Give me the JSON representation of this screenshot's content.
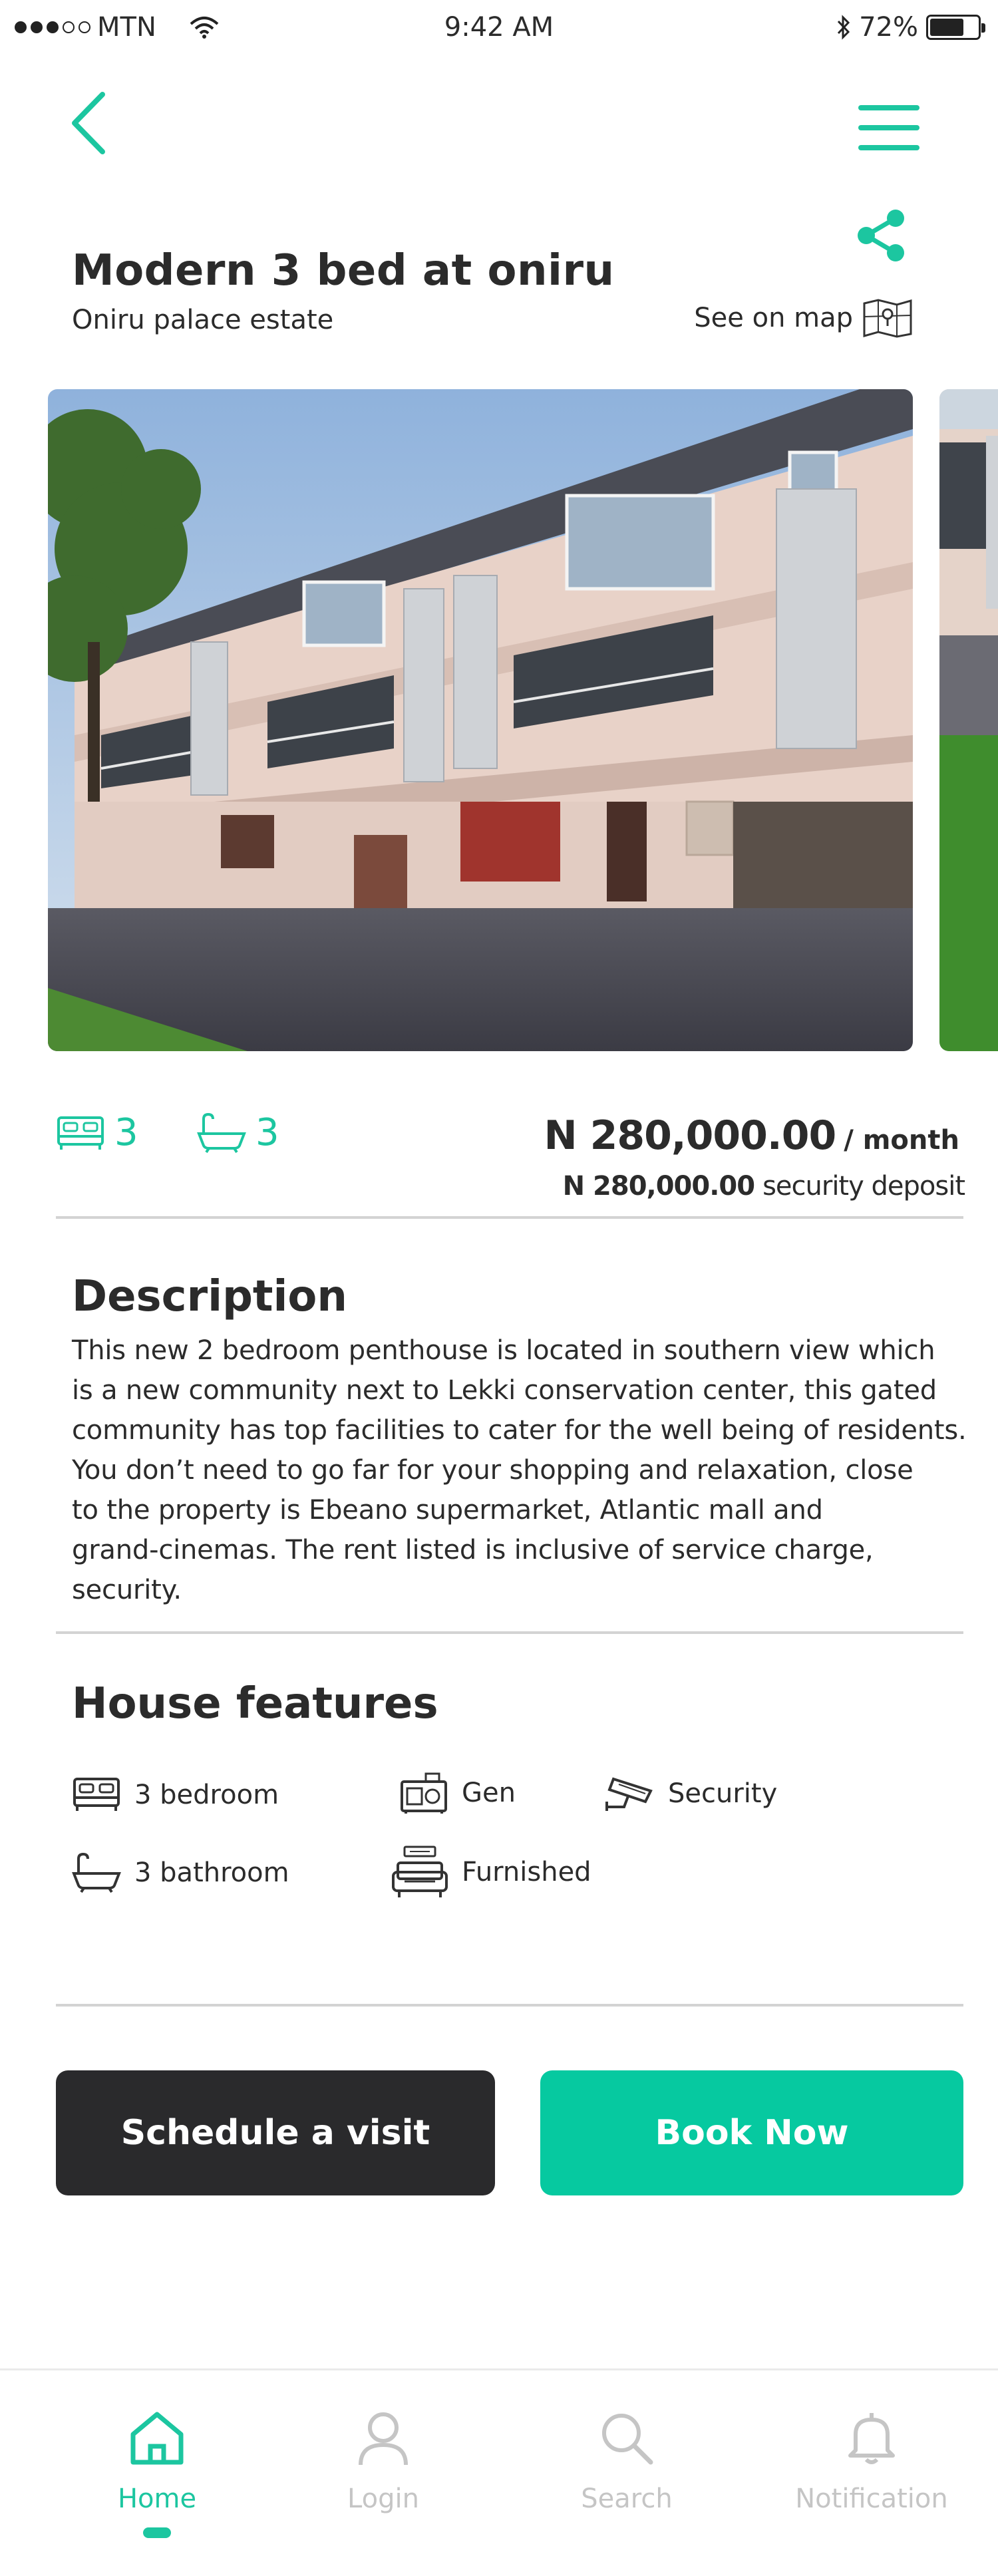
{
  "status_bar": {
    "carrier": "MTN",
    "time": "9:42 AM",
    "battery": "72%",
    "battery_level": 0.72
  },
  "listing": {
    "title": "Modern 3 bed at oniru",
    "location": "Oniru palace estate",
    "see_on_map": "See on map",
    "bedrooms": "3",
    "bathrooms": "3",
    "price": "N 280,000.00",
    "price_period": "/ month",
    "deposit_amount": "N 280,000.00",
    "deposit_label": "security deposit"
  },
  "description": {
    "heading": "Description",
    "text": "This new 2 bedroom penthouse is located in southern view which\n is a new community next to Lekki conservation center, this gated\n community has top facilities to cater for the well being of residents.\nYou don’t need to go far for your shopping and relaxation, close\nto the property is Ebeano supermarket, Atlantic mall and\ngrand-cinemas. The rent listed is inclusive of service charge,\nsecurity."
  },
  "features": {
    "heading": "House features",
    "items": [
      {
        "label": "3 bedroom",
        "icon": "bed-icon"
      },
      {
        "label": "Gen",
        "icon": "generator-icon"
      },
      {
        "label": "Security",
        "icon": "cctv-camera-icon"
      },
      {
        "label": "3 bathroom",
        "icon": "bathtub-icon"
      },
      {
        "label": "Furnished",
        "icon": "sofa-icon"
      }
    ]
  },
  "actions": {
    "schedule_label": "Schedule a visit",
    "book_label": "Book Now"
  },
  "tabs": [
    {
      "label": "Home",
      "icon": "home-icon",
      "active": true
    },
    {
      "label": "Login",
      "icon": "user-icon",
      "active": false
    },
    {
      "label": "Search",
      "icon": "search-icon",
      "active": false
    },
    {
      "label": "Notification",
      "icon": "bell-icon",
      "active": false
    }
  ],
  "colors": {
    "accent": "#06c9a0",
    "dark_button": "#2a2a2c",
    "text": "#2b2b2b",
    "inactive_tab": "#c5c5c5"
  }
}
